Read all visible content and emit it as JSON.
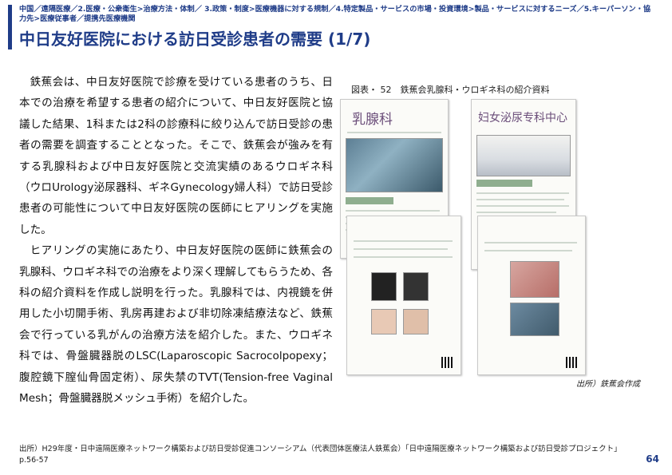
{
  "header": {
    "breadcrumb": "中国／遠隔医療／2.医療・公衆衛生>治療方法・体制／ 3.政策・制度>医療機器に対する規制／4.特定製品・サービスの市場・投資環境>製品・サービスに対するニーズ／5.キーパーソン・協力先>医療従事者／提携先医療機関",
    "title": "中日友好医院における訪日受診患者の需要 (1/7)"
  },
  "body": {
    "paragraph1": "鉄蕉会は、中日友好医院で診療を受けている患者のうち、日本での治療を希望する患者の紹介について、中日友好医院と協議した結果、1科または2科の診療科に絞り込んで訪日受診の患者の需要を調査することとなった。そこで、鉄蕉会が強みを有する乳腺科および中日友好医院と交流実績のあるウロギネ科（ウロUrology泌尿器科、ギネGynecology婦人科）で訪日受診患者の可能性について中日友好医院の医師にヒアリングを実施した。",
    "paragraph2": "ヒアリングの実施にあたり、中日友好医院の医師に鉄蕉会の乳腺科、ウロギネ科での治療をより深く理解してもらうため、各科の紹介資料を作成し説明を行った。乳腺科では、内視鏡を併用した小切開手術、乳房再建および非切除凍結療法など、鉄蕉会で行っている乳がんの治療方法を紹介した。また、ウロギネ科では、骨盤臓器脱のLSC(Laparoscopic Sacrocolpopexy；腹腔鏡下膣仙骨固定術）、尿失禁のTVT(Tension-free Vaginal Mesh；骨盤臓器脱メッシュ手術）を紹介した。"
  },
  "figure": {
    "title": "図表・ 52　鉄蕉会乳腺科・ウロギネ科の紹介資料",
    "source": "出所）鉄蕉会作成",
    "doc_left_title": "乳腺科",
    "doc_right_title": "妇女泌尿专科中心"
  },
  "footer": {
    "note": "出所）H29年度・日中遠隔医療ネットワーク構築および訪日受診促進コンソーシアム（代表団体医療法人鉄蕉会）「日中遠隔医療ネットワーク構築および訪日受診プロジェクト」p.56-57",
    "page_number": "64"
  },
  "colors": {
    "accent": "#1f3c88",
    "doc_title": "#6b4e7a",
    "doc_band": "#8fae8f"
  }
}
